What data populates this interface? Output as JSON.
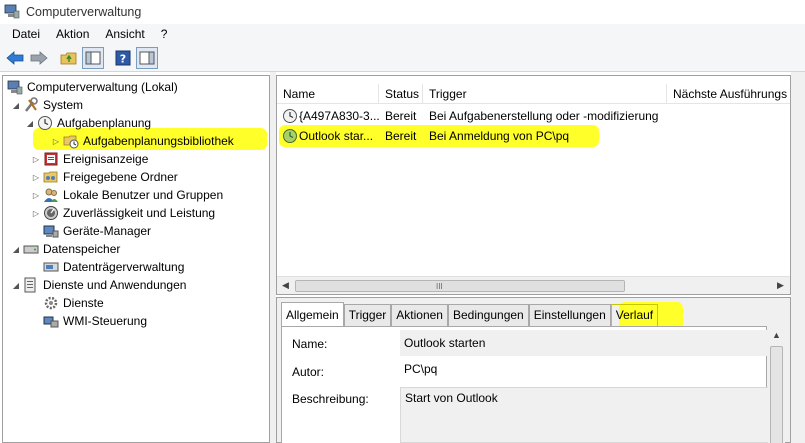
{
  "window": {
    "title": "Computerverwaltung"
  },
  "menu": [
    "Datei",
    "Aktion",
    "Ansicht",
    "?"
  ],
  "toolbar": {
    "icons": [
      "back-arrow-icon",
      "forward-arrow-icon",
      "up-folder-icon",
      "show-hide-tree-icon",
      "help-icon",
      "show-hide-action-pane-icon"
    ]
  },
  "tree": {
    "root": "Computerverwaltung (Lokal)",
    "system": "System",
    "aufgabenplanung": "Aufgabenplanung",
    "bibliothek": "Aufgabenplanungsbibliothek",
    "ereignisanzeige": "Ereignisanzeige",
    "freigegebene": "Freigegebene Ordner",
    "benutzer": "Lokale Benutzer und Gruppen",
    "zuverlaessigkeit": "Zuverlässigkeit und Leistung",
    "geraete": "Geräte-Manager",
    "datenspeicher": "Datenspeicher",
    "datentraeger": "Datenträgerverwaltung",
    "dienste_anw": "Dienste und Anwendungen",
    "dienste": "Dienste",
    "wmi": "WMI-Steuerung"
  },
  "list": {
    "columns": [
      "Name",
      "Status",
      "Trigger",
      "Nächste Ausführungs"
    ],
    "rows": [
      {
        "name": "{A497A830-3...",
        "status": "Bereit",
        "trigger": "Bei Aufgabenerstellung oder -modifizierung",
        "next": ""
      },
      {
        "name": "Outlook star...",
        "status": "Bereit",
        "trigger": "Bei Anmeldung von PC\\pq",
        "next": ""
      }
    ],
    "scroll_grip": "III"
  },
  "tabs": [
    "Allgemein",
    "Trigger",
    "Aktionen",
    "Bedingungen",
    "Einstellungen",
    "Verlauf"
  ],
  "general": {
    "name_label": "Name:",
    "name_value": "Outlook starten",
    "author_label": "Autor:",
    "author_value": "PC\\pq",
    "desc_label": "Beschreibung:",
    "desc_value": "Start von Outlook"
  },
  "colors": {
    "highlight": "#ffff2a",
    "accent_blue": "#1e6fd0"
  }
}
